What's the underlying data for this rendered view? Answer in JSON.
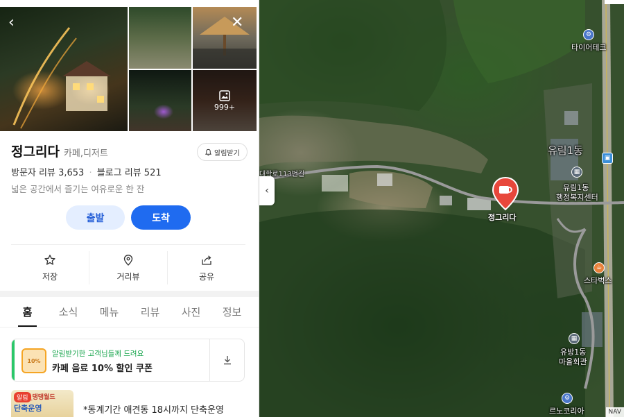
{
  "place": {
    "name": "정그리다",
    "category": "카페,디저트",
    "notify_label": "알림받기",
    "visitor_reviews_label": "방문자 리뷰",
    "visitor_reviews_count": "3,653",
    "blog_reviews_label": "블로그 리뷰",
    "blog_reviews_count": "521",
    "description": "넓은 공간에서 즐기는 여유로운 한 잔"
  },
  "gallery": {
    "more_count": "999+"
  },
  "route": {
    "depart_label": "출발",
    "arrive_label": "도착"
  },
  "actions": [
    {
      "label": "저장",
      "icon": "star-icon"
    },
    {
      "label": "거리뷰",
      "icon": "location-pin-icon"
    },
    {
      "label": "공유",
      "icon": "share-icon"
    }
  ],
  "tabs": [
    {
      "label": "홈",
      "active": true
    },
    {
      "label": "소식",
      "active": false
    },
    {
      "label": "메뉴",
      "active": false
    },
    {
      "label": "리뷰",
      "active": false
    },
    {
      "label": "사진",
      "active": false
    },
    {
      "label": "정보",
      "active": false
    }
  ],
  "coupon": {
    "sub_text": "알림받기한 고객님들께 드려요",
    "main_text": "카페 음료 10% 할인 쿠폰",
    "badge_text": "10%"
  },
  "news": {
    "badge": "알림",
    "thumb_line1": "_댕댕월드",
    "thumb_line2": "단축운영",
    "text": "*동계기간 애견동 18시까지 단축운영"
  },
  "map": {
    "pin_label": "정그리다",
    "labels": {
      "tire": "타이어테크",
      "yurim1": "유림1동",
      "yurim_office_1": "유림1동",
      "yurim_office_2": "행정복지센터",
      "starbucks": "스타벅스",
      "yubang1": "유방1동",
      "yubang_hall": "마을회관",
      "lenocoria": "르노코리아",
      "road": "대학로113번길"
    },
    "nav_badge": "NAV",
    "colors": {
      "pin": "#e8473b",
      "road": "#9a9a9a"
    }
  },
  "colors": {
    "primary": "#1f6bf0",
    "coupon_accent": "#2ac769"
  }
}
